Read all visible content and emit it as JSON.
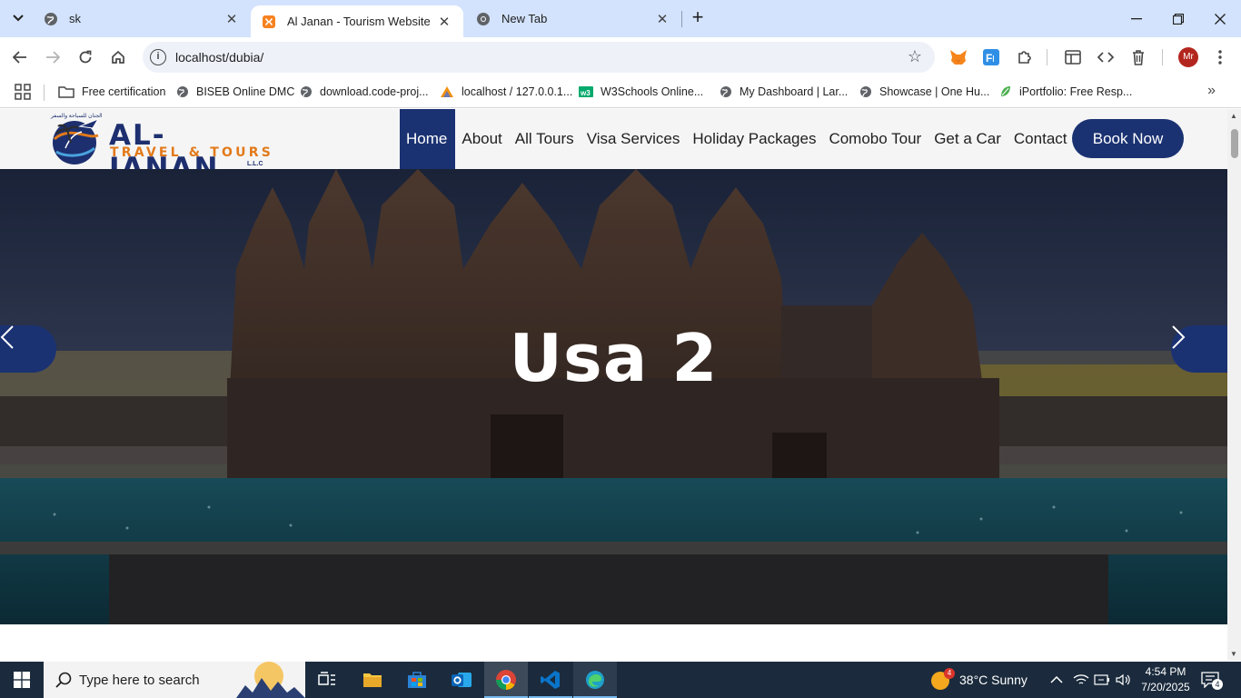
{
  "browser": {
    "tabs": [
      {
        "title": "sk",
        "active": false
      },
      {
        "title": "Al Janan - Tourism Website Template",
        "active": true
      },
      {
        "title": "New Tab",
        "active": false
      }
    ],
    "url": "localhost/dubia/",
    "profile_initials": "Mr",
    "bookmarks": [
      {
        "label": "Free certification",
        "icon": "folder-icon"
      },
      {
        "label": "BISEB Online DMC",
        "icon": "globe-icon"
      },
      {
        "label": "download.code-proj...",
        "icon": "globe-icon"
      },
      {
        "label": "localhost / 127.0.0.1...",
        "icon": "phpmyadmin-icon"
      },
      {
        "label": "W3Schools Online...",
        "icon": "w3schools-icon"
      },
      {
        "label": "My Dashboard | Lar...",
        "icon": "globe-icon"
      },
      {
        "label": "Showcase | One Hu...",
        "icon": "globe-icon"
      },
      {
        "label": "iPortfolio: Free Resp...",
        "icon": "leaf-icon"
      }
    ]
  },
  "site": {
    "logo": {
      "main": "AL-JANAN",
      "sub": "TRAVEL & TOURS",
      "suffix": "L.L.C",
      "arabic": "الجنان للسياحة والسفر"
    },
    "nav": [
      {
        "label": "Home",
        "active": true
      },
      {
        "label": "About",
        "active": false
      },
      {
        "label": "All Tours",
        "active": false
      },
      {
        "label": "Visa Services",
        "active": false
      },
      {
        "label": "Holiday Packages",
        "active": false
      },
      {
        "label": "Comobo Tour",
        "active": false
      },
      {
        "label": "Get a Car",
        "active": false
      },
      {
        "label": "Contact",
        "active": false
      }
    ],
    "cta": "Book Now",
    "hero": {
      "title": "Usa 2",
      "prev_icon": "chevron-left-icon",
      "next_icon": "chevron-right-icon"
    },
    "colors": {
      "brand_navy": "#1b3272",
      "brand_orange": "#e27a1b"
    }
  },
  "taskbar": {
    "search_placeholder": "Type here to search",
    "weather_badge": "4",
    "weather": "38°C  Sunny",
    "time": "4:54 PM",
    "date": "7/20/2025",
    "notification_count": "4"
  }
}
